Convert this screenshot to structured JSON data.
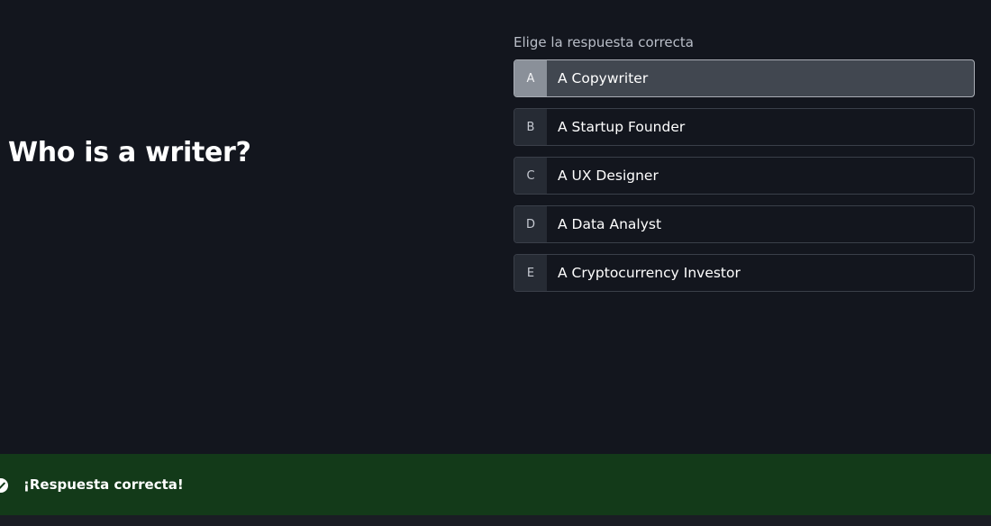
{
  "question": {
    "text": "Who is a writer?"
  },
  "answers": {
    "prompt": "Elige la respuesta correcta",
    "options": [
      {
        "key": "A",
        "label": "A Copywriter",
        "selected": true
      },
      {
        "key": "B",
        "label": "A Startup Founder",
        "selected": false
      },
      {
        "key": "C",
        "label": "A UX Designer",
        "selected": false
      },
      {
        "key": "D",
        "label": "A Data Analyst",
        "selected": false
      },
      {
        "key": "E",
        "label": "A Cryptocurrency Investor",
        "selected": false
      }
    ]
  },
  "feedback": {
    "icon": "check-circle-icon",
    "text": "¡Respuesta correcta!",
    "color": "#133a19"
  }
}
